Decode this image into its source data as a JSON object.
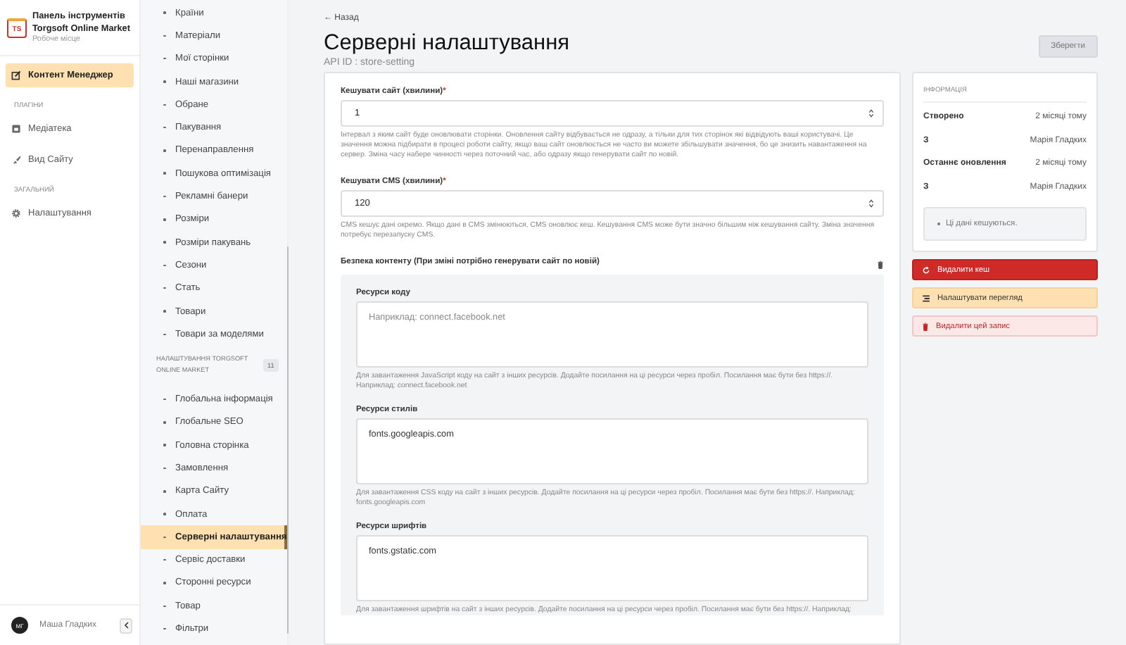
{
  "app": {
    "logo": "TS",
    "title": "Панель інструментів",
    "subtitle": "Torgsoft Online Market",
    "workspace": "Робоче місце"
  },
  "nav": [
    {
      "kind": "item",
      "label": "Контент Менеджер",
      "selected": true
    },
    {
      "kind": "heading",
      "label": "ПЛАГІНИ"
    },
    {
      "kind": "item",
      "label": "Медіатека",
      "selected": false
    },
    {
      "kind": "item",
      "label": "Вид Сайту",
      "selected": false
    },
    {
      "kind": "heading",
      "label": "ЗАГАЛЬНИЙ"
    },
    {
      "kind": "item",
      "label": "Налаштування",
      "selected": false
    }
  ],
  "user": {
    "initials": "МГ",
    "name": "Маша Гладких"
  },
  "collections": [
    {
      "kind": "item",
      "label": "Країни",
      "selected": false
    },
    {
      "kind": "item",
      "label": "Матеріали",
      "selected": false
    },
    {
      "kind": "item",
      "label": "Мої сторінки",
      "selected": false
    },
    {
      "kind": "item",
      "label": "Наші магазини",
      "selected": false
    },
    {
      "kind": "item",
      "label": "Обране",
      "selected": false
    },
    {
      "kind": "item",
      "label": "Пакування",
      "selected": false
    },
    {
      "kind": "item",
      "label": "Перенаправлення",
      "selected": false
    },
    {
      "kind": "item",
      "label": "Пошукова оптимізація",
      "selected": false
    },
    {
      "kind": "item",
      "label": "Рекламні банери",
      "selected": false
    },
    {
      "kind": "item",
      "label": "Розміри",
      "selected": false
    },
    {
      "kind": "item",
      "label": "Розміри пакувань",
      "selected": false
    },
    {
      "kind": "item",
      "label": "Сезони",
      "selected": false
    },
    {
      "kind": "item",
      "label": "Стать",
      "selected": false
    },
    {
      "kind": "item",
      "label": "Товари",
      "selected": false
    },
    {
      "kind": "item",
      "label": "Товари за моделями",
      "selected": false
    },
    {
      "kind": "heading",
      "label": "НАЛАШТУВАННЯ TORGSOFT ONLINE MARKET",
      "count": "11"
    },
    {
      "kind": "item",
      "label": "Глобальна інформація",
      "selected": false
    },
    {
      "kind": "item",
      "label": "Глобальне SEO",
      "selected": false
    },
    {
      "kind": "item",
      "label": "Головна сторінка",
      "selected": false
    },
    {
      "kind": "item",
      "label": "Замовлення",
      "selected": false
    },
    {
      "kind": "item",
      "label": "Карта Сайту",
      "selected": false
    },
    {
      "kind": "item",
      "label": "Оплата",
      "selected": false
    },
    {
      "kind": "item",
      "label": "Серверні налаштування",
      "selected": true
    },
    {
      "kind": "item",
      "label": "Сервіс доставки",
      "selected": false
    },
    {
      "kind": "item",
      "label": "Сторонні ресурси",
      "selected": false
    },
    {
      "kind": "item",
      "label": "Товар",
      "selected": false
    },
    {
      "kind": "item",
      "label": "Фільтри",
      "selected": false
    }
  ],
  "header": {
    "back": "← Назад",
    "title": "Серверні налаштування",
    "api_id": "API ID : store-setting",
    "save": "Зберегти"
  },
  "fields": [
    {
      "kind": "number",
      "label": "Кешувати сайт (хвилини)",
      "required_mark": "*",
      "value": "1",
      "help": "Інтервал з яким сайт буде оновлювати сторінки. Оновлення сайту відбувається не одразу, а тільки для тих сторінок які відвідують ваші користувачі. Це значення можна підбирати в процесі роботи сайту, якщо ваш сайт оновлюється не часто ви можете збільшувати значення, бо це знизить навантаження на сервер. Зміна часу набере чинності через поточний час, або одразу якщо генерувати сайт по новій."
    },
    {
      "kind": "number",
      "label": "Кешувати CMS (хвилини)",
      "required_mark": "*",
      "value": "120",
      "help": "CMS кешує дані окремо. Якщо дані в CMS змінюються, CMS оновлює кеш. Кешування CMS може бути значно більшим ніж кешування сайту. Зміна значення потребує перезапуску CMS."
    }
  ],
  "security": {
    "title": "Безпека контенту (При зміні потрібно генерувати сайт по новій)",
    "fields": [
      {
        "label": "Ресурси коду",
        "placeholder": "Наприклад: connect.facebook.net",
        "help": "Для завантаження JavaScript коду на сайт з інших ресурсів. Додайте посилання на ці ресурси через пробіл. Посилання має бути без https://. Наприклад: connect.facebook.net"
      },
      {
        "label": "Ресурси стилів",
        "value": "fonts.googleapis.com",
        "help": "Для завантаження CSS коду на сайт з інших ресурсів. Додайте посилання на ці ресурси через пробіл. Посилання має бути без https://. Наприклад: fonts.googleapis.com"
      },
      {
        "label": "Ресурси шрифтів",
        "value": "fonts.gstatic.com",
        "help": "Для завантаження шрифтів на сайт з інших ресурсів. Додайте посилання на ці ресурси через пробіл. Посилання має бути без https://. Наприклад:"
      }
    ]
  },
  "info": {
    "title": "ІНФОРМАЦІЯ",
    "rows": [
      {
        "label": "Створено",
        "value": "2 місяці тому"
      },
      {
        "label": "З",
        "value": "Марія Гладких"
      },
      {
        "label": "Останнє оновлення",
        "value": "2 місяці тому"
      },
      {
        "label": "З",
        "value": "Марія Гладких"
      }
    ],
    "note": "Ці дані кешуються."
  },
  "actions": [
    {
      "kind": "danger",
      "label": "Видалити кеш"
    },
    {
      "kind": "warning",
      "label": "Налаштувати перегляд"
    },
    {
      "kind": "light-danger",
      "label": "Видалити цей запис"
    }
  ]
}
